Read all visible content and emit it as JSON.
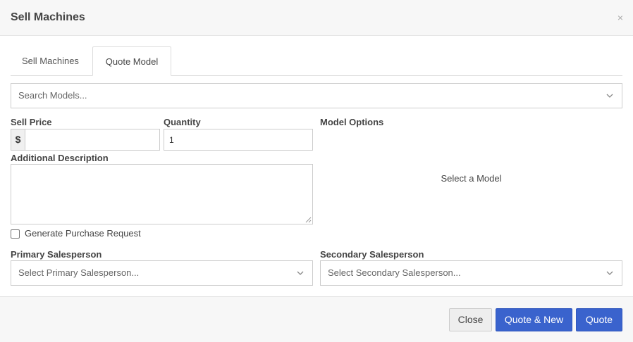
{
  "modal": {
    "title": "Sell Machines",
    "close_glyph": "×"
  },
  "tabs": [
    {
      "label": "Sell Machines",
      "active": false
    },
    {
      "label": "Quote Model",
      "active": true
    }
  ],
  "model_search": {
    "placeholder": "Search Models...",
    "icon": "chevron-down-icon"
  },
  "sell_price": {
    "label": "Sell Price",
    "currency_symbol": "$",
    "value": ""
  },
  "quantity": {
    "label": "Quantity",
    "value": "1"
  },
  "model_options": {
    "label": "Model Options",
    "empty_text": "Select a Model"
  },
  "additional_description": {
    "label": "Additional Description",
    "value": ""
  },
  "purchase_request": {
    "label": "Generate Purchase Request",
    "checked": false
  },
  "primary_salesperson": {
    "label": "Primary Salesperson",
    "placeholder": "Select Primary Salesperson..."
  },
  "secondary_salesperson": {
    "label": "Secondary Salesperson",
    "placeholder": "Select Secondary Salesperson..."
  },
  "footer": {
    "close_label": "Close",
    "quote_new_label": "Quote & New",
    "quote_label": "Quote"
  },
  "colors": {
    "primary_button": "#3a63cd",
    "header_bg": "#f7f7f7",
    "border": "#cccccc"
  }
}
